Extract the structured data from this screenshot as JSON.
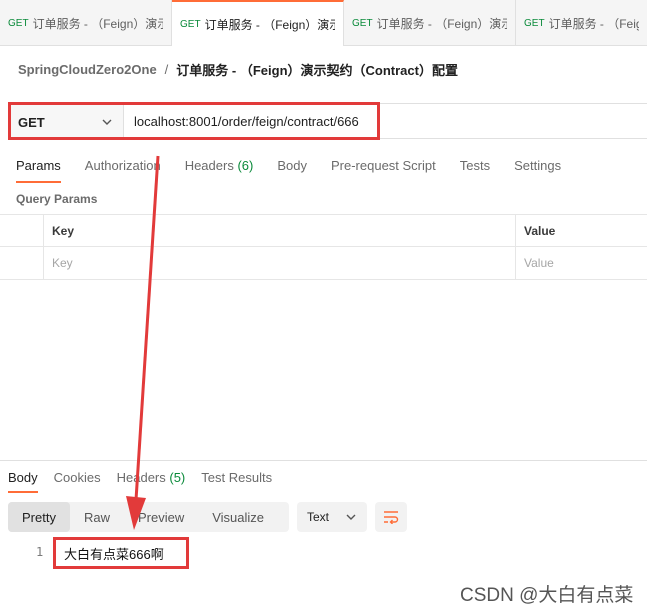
{
  "tabs": [
    {
      "method": "GET",
      "name": "订单服务 - （Feign）演示|",
      "active": false
    },
    {
      "method": "GET",
      "name": "订单服务 - （Feign）演示",
      "active": true
    },
    {
      "method": "GET",
      "name": "订单服务 - （Feign）演示",
      "active": false
    },
    {
      "method": "GET",
      "name": "订单服务 - （Feign）",
      "active": false
    }
  ],
  "breadcrumb": {
    "workspace": "SpringCloudZero2One",
    "separator": "/",
    "request": "订单服务 - （Feign）演示契约（Contract）配置"
  },
  "urlbar": {
    "method": "GET",
    "url": "localhost:8001/order/feign/contract/666"
  },
  "request_tabs": [
    {
      "label": "Params",
      "count": ""
    },
    {
      "label": "Authorization",
      "count": ""
    },
    {
      "label": "Headers",
      "count": "(6)"
    },
    {
      "label": "Body",
      "count": ""
    },
    {
      "label": "Pre-request Script",
      "count": ""
    },
    {
      "label": "Tests",
      "count": ""
    },
    {
      "label": "Settings",
      "count": ""
    }
  ],
  "query_params": {
    "title": "Query Params",
    "headers": {
      "key": "Key",
      "value": "Value"
    },
    "placeholder": {
      "key": "Key",
      "value": "Value"
    }
  },
  "response_tabs": [
    {
      "label": "Body",
      "count": ""
    },
    {
      "label": "Cookies",
      "count": ""
    },
    {
      "label": "Headers",
      "count": "(5)"
    },
    {
      "label": "Test Results",
      "count": ""
    }
  ],
  "view_modes": [
    "Pretty",
    "Raw",
    "Preview",
    "Visualize"
  ],
  "format": "Text",
  "response_body": {
    "line": "1",
    "text": "大白有点菜666啊"
  },
  "watermark": "CSDN @大白有点菜",
  "colors": {
    "accent": "#ff6c37",
    "highlight_box": "#e23a3a",
    "count_green": "#0a8a3a"
  }
}
